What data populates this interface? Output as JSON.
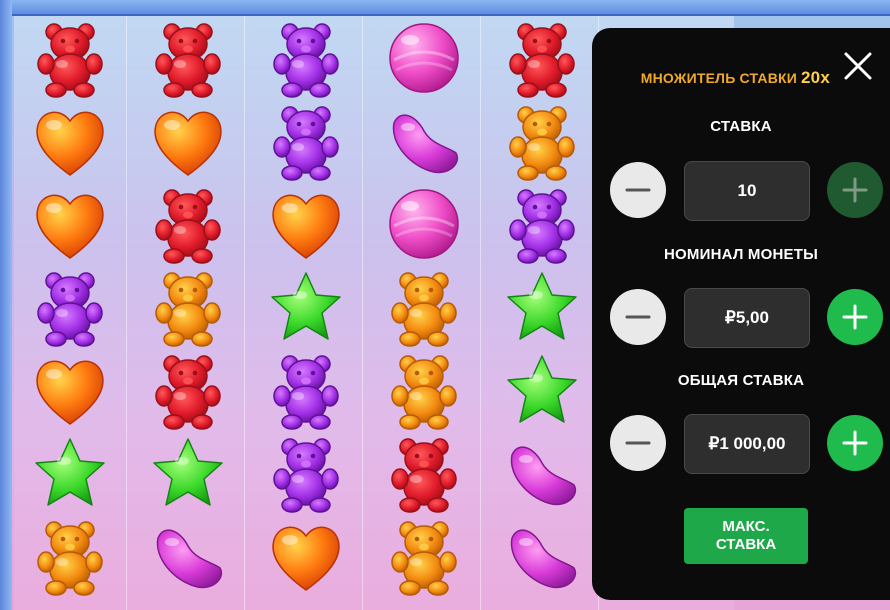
{
  "panel": {
    "multiplier_label": "МНОЖИТЕЛЬ СТАВКИ",
    "multiplier_value": "20x",
    "bet": {
      "label": "СТАВКА",
      "value": "10",
      "plus_enabled": false
    },
    "coin": {
      "label": "НОМИНАЛ МОНЕТЫ",
      "value": "₽5,00"
    },
    "total": {
      "label": "ОБЩАЯ СТАВКА",
      "value": "₽1 000,00"
    },
    "max_button": {
      "line1": "МАКС.",
      "line2": "СТАВКА"
    }
  },
  "grid": {
    "columns": 5,
    "rows": 7,
    "symbols": [
      [
        "red-bear",
        "orange-heart",
        "orange-heart",
        "purple-bear",
        "orange-heart",
        "green-star",
        "orange-bear"
      ],
      [
        "red-bear",
        "orange-heart",
        "red-bear",
        "orange-bear",
        "red-bear",
        "green-star",
        "purple-bean"
      ],
      [
        "purple-bear",
        "purple-bear",
        "orange-heart",
        "green-star",
        "purple-bear",
        "purple-bear",
        "orange-heart"
      ],
      [
        "pink-lollipop",
        "purple-bean",
        "pink-lollipop",
        "orange-bear",
        "orange-bear",
        "red-bear",
        "orange-bear"
      ],
      [
        "red-bear",
        "orange-bear",
        "purple-bear",
        "green-star",
        "green-star",
        "purple-bean",
        "purple-bean"
      ]
    ]
  },
  "colors": {
    "panel_bg": "#0b0b0b",
    "accent_gold": "#f0a92a",
    "plus_green": "#1fbb4c",
    "plus_disabled": "#1f5a30",
    "minus_gray": "#e9e9e9",
    "max_green": "#1fa84a"
  },
  "icons": {
    "close": "close-icon",
    "minus": "minus-icon",
    "plus": "plus-icon"
  }
}
